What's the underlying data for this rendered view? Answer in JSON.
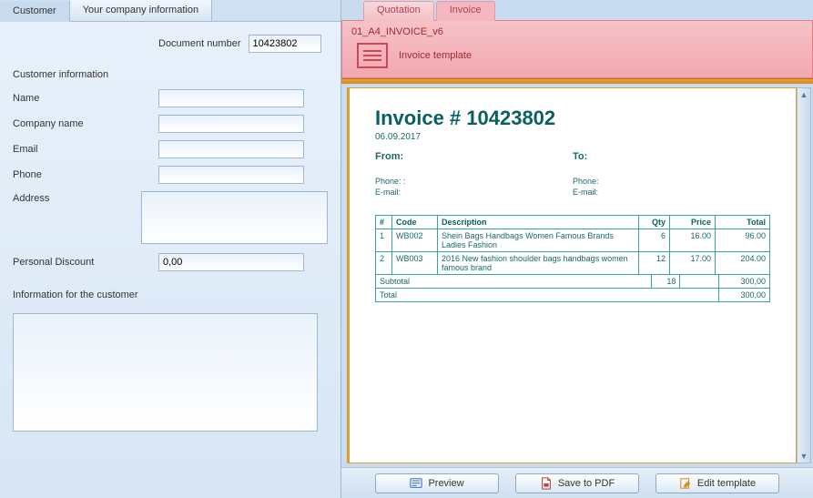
{
  "leftTabs": {
    "customer": "Customer",
    "company": "Your company information"
  },
  "rightTabs": {
    "quotation": "Quotation",
    "invoice": "Invoice"
  },
  "docnum": {
    "label": "Document number",
    "value": "10423802"
  },
  "sections": {
    "custinfo": "Customer information",
    "infoForCustomer": "Information for the customer"
  },
  "fields": {
    "name": {
      "label": "Name",
      "value": ""
    },
    "company": {
      "label": "Company name",
      "value": ""
    },
    "email": {
      "label": "Email",
      "value": ""
    },
    "phone": {
      "label": "Phone",
      "value": ""
    },
    "address": {
      "label": "Address",
      "value": ""
    },
    "discount": {
      "label": "Personal Discount",
      "value": "0,00"
    },
    "note": {
      "value": ""
    }
  },
  "template": {
    "file": "01_A4_INVOICE_v6",
    "label": "Invoice template"
  },
  "invoice": {
    "title": "Invoice # 10423802",
    "date": "06.09.2017",
    "fromLabel": "From:",
    "toLabel": "To:",
    "phoneLabel": "Phone:",
    "emailLabel": "E-mail:",
    "cols": {
      "n": "#",
      "code": "Code",
      "desc": "Description",
      "qty": "Qty",
      "price": "Price",
      "total": "Total"
    },
    "rows": [
      {
        "n": "1",
        "code": "WB002",
        "desc": "Shein Bags Handbags Women Famous Brands Ladies Fashion",
        "qty": "6",
        "price": "16.00",
        "total": "96.00"
      },
      {
        "n": "2",
        "code": "WB003",
        "desc": "2016 New fashion shoulder bags handbags women famous brand",
        "qty": "12",
        "price": "17.00",
        "total": "204.00"
      }
    ],
    "subtotal": {
      "label": "Subtotal",
      "qty": "18",
      "amount": "300,00"
    },
    "total": {
      "label": "Total",
      "amount": "300,00"
    }
  },
  "buttons": {
    "preview": "Preview",
    "savepdf": "Save to PDF",
    "edit": "Edit template"
  }
}
